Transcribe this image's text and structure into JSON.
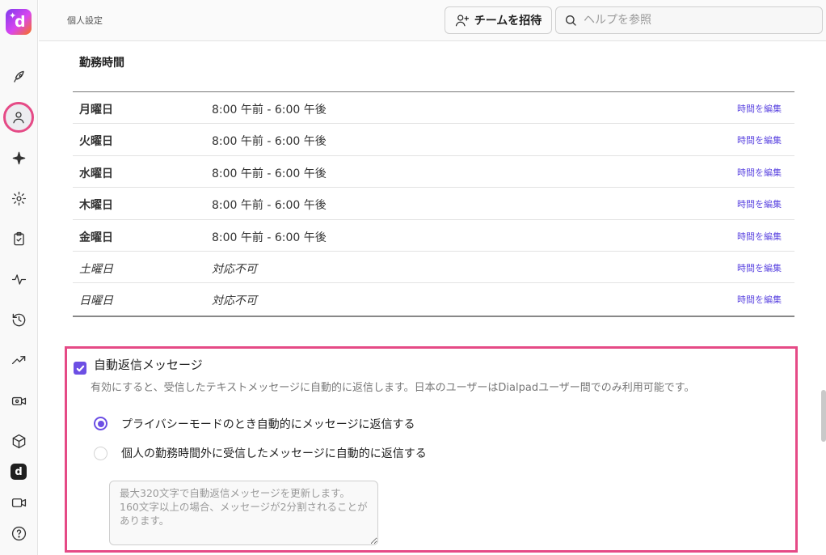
{
  "header": {
    "breadcrumb": "個人設定",
    "invite_label": "チームを招待",
    "search_placeholder": "ヘルプを参照"
  },
  "working_hours": {
    "title": "勤務時間",
    "edit_label": "時間を編集",
    "rows": [
      {
        "day": "月曜日",
        "time": "8:00 午前 - 6:00 午後"
      },
      {
        "day": "火曜日",
        "time": "8:00 午前 - 6:00 午後"
      },
      {
        "day": "水曜日",
        "time": "8:00 午前 - 6:00 午後"
      },
      {
        "day": "木曜日",
        "time": "8:00 午前 - 6:00 午後"
      },
      {
        "day": "金曜日",
        "time": "8:00 午前 - 6:00 午後"
      },
      {
        "day": "土曜日",
        "time": "対応不可"
      },
      {
        "day": "日曜日",
        "time": "対応不可"
      }
    ]
  },
  "auto_reply": {
    "enabled": true,
    "title": "自動返信メッセージ",
    "description": "有効にすると、受信したテキストメッセージに自動的に返信します。日本のユーザーはDialpadユーザー間でのみ利用可能です。",
    "options": [
      {
        "label": "プライバシーモードのとき自動的にメッセージに返信する",
        "selected": true
      },
      {
        "label": "個人の勤務時間外に受信したメッセージに自動的に返信する",
        "selected": false
      }
    ],
    "message_placeholder": "最大320文字で自動返信メッセージを更新します。160文字以上の場合、メッセージが2分割されることがあります。"
  },
  "colors": {
    "accent": "#6c4fe4",
    "highlight": "#e54a86"
  },
  "sidebar": {
    "icons": [
      "rocket-icon",
      "person-icon",
      "sparkle-icon",
      "gear-icon",
      "clipboard-icon",
      "activity-icon",
      "history-icon",
      "trend-icon",
      "video-settings-icon",
      "cube-icon",
      "dialpad-logo-icon",
      "camera-icon",
      "help-icon"
    ]
  }
}
